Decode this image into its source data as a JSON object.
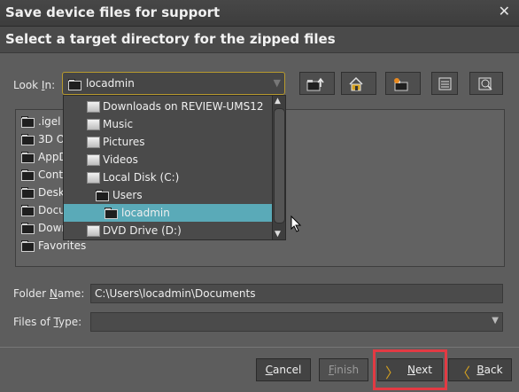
{
  "window": {
    "title": "Save device files for support",
    "close_glyph": "✕"
  },
  "header": {
    "text": "Select a target directory for the zipped files"
  },
  "look_in": {
    "label_prefix": "Look ",
    "label_hotkey": "I",
    "label_suffix": "n:",
    "value": "locadmin",
    "arrow": "▼"
  },
  "toolbar": [
    "up-folder-icon",
    "home-icon",
    "new-folder-icon",
    "list-view-icon",
    "details-view-icon"
  ],
  "file_list": [
    {
      "label": ".igel"
    },
    {
      "label": "3D O"
    },
    {
      "label": "AppD"
    },
    {
      "label": "Cont"
    },
    {
      "label": "Desk"
    },
    {
      "label": "Docu"
    },
    {
      "label": "Down"
    },
    {
      "label": "Favorites"
    }
  ],
  "dropdown": {
    "items": [
      {
        "label": "Downloads on REVIEW-UMS12",
        "icon": "drive-icon",
        "indent": 0
      },
      {
        "label": "Music",
        "icon": "drive-icon",
        "indent": 0
      },
      {
        "label": "Pictures",
        "icon": "drive-icon",
        "indent": 0
      },
      {
        "label": "Videos",
        "icon": "drive-icon",
        "indent": 0
      },
      {
        "label": "Local Disk (C:)",
        "icon": "drive-icon",
        "indent": 0
      },
      {
        "label": "Users",
        "icon": "folder-icon",
        "indent": 1
      },
      {
        "label": "locadmin",
        "icon": "folder-icon",
        "indent": 2,
        "selected": true
      },
      {
        "label": "DVD Drive (D:)",
        "icon": "drive-icon",
        "indent": 0
      }
    ],
    "scroll_up": "▲",
    "scroll_down": "▼"
  },
  "folder_name": {
    "label_prefix": "Folder ",
    "label_hotkey": "N",
    "label_suffix": "ame:",
    "value": "C:\\Users\\locadmin\\Documents"
  },
  "files_of_type": {
    "label_prefix": "Files of ",
    "label_hotkey": "T",
    "label_suffix": "ype:",
    "value": "",
    "arrow": "▼"
  },
  "buttons": {
    "cancel": {
      "hotkey": "C",
      "rest": "ancel"
    },
    "finish": {
      "hotkey": "F",
      "rest": "inish"
    },
    "next": {
      "hotkey": "N",
      "rest": "ext",
      "chevron": "〉"
    },
    "back": {
      "hotkey": "B",
      "rest": "ack",
      "chevron": "〈"
    }
  },
  "colors": {
    "accent_border": "#b89a2e",
    "selection": "#5aaab8",
    "highlight": "#e23a43"
  }
}
